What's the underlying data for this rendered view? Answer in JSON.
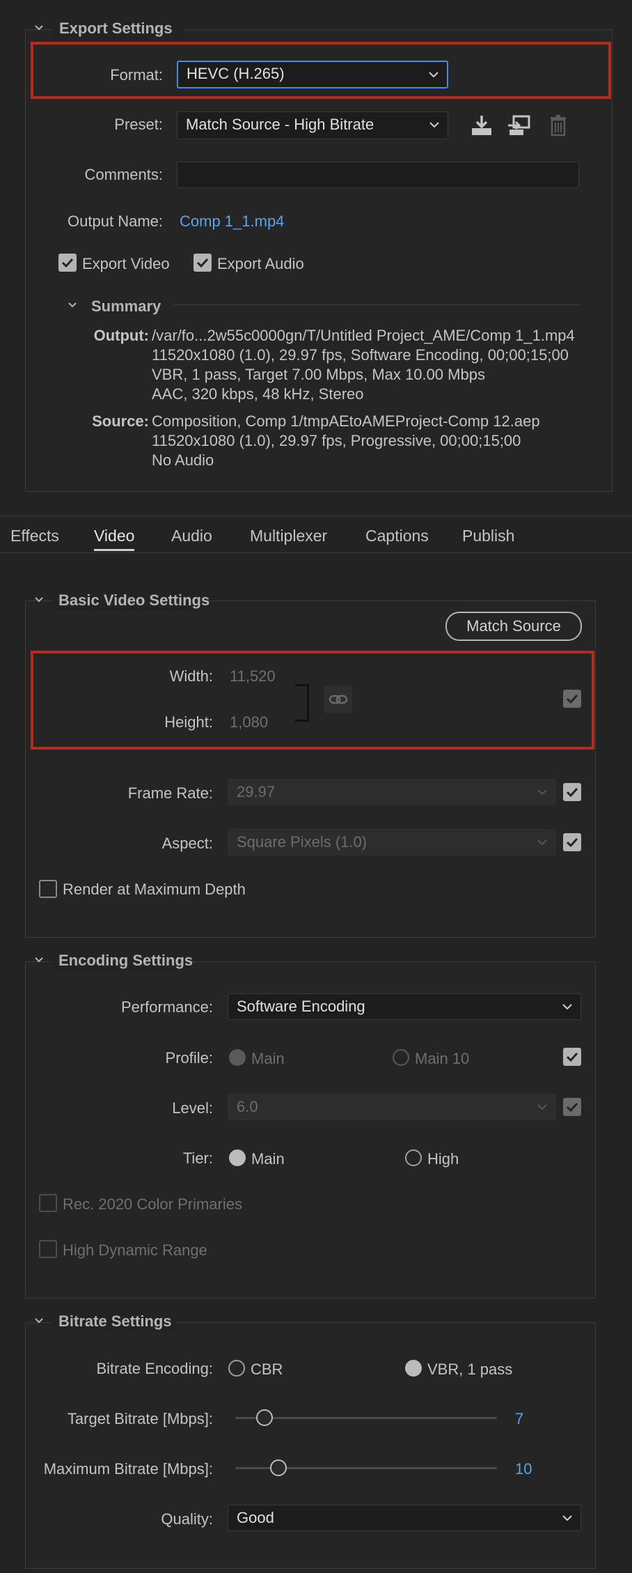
{
  "export_settings": {
    "title": "Export Settings",
    "format_label": "Format:",
    "format_value": "HEVC (H.265)",
    "preset_label": "Preset:",
    "preset_value": "Match Source - High Bitrate",
    "comments_label": "Comments:",
    "comments_value": "",
    "output_name_label": "Output Name:",
    "output_name_value": "Comp 1_1.mp4",
    "export_video_label": "Export Video",
    "export_video_checked": true,
    "export_audio_label": "Export Audio",
    "export_audio_checked": true,
    "summary": {
      "title": "Summary",
      "output_label": "Output:",
      "output_lines": [
        "/var/fo...2w55c0000gn/T/Untitled Project_AME/Comp 1_1.mp4",
        "11520x1080 (1.0), 29.97 fps, Software Encoding, 00;00;15;00",
        "VBR, 1 pass, Target 7.00 Mbps, Max 10.00 Mbps",
        "AAC, 320 kbps, 48 kHz, Stereo"
      ],
      "source_label": "Source:",
      "source_lines": [
        "Composition, Comp 1/tmpAEtoAMEProject-Comp 12.aep",
        "11520x1080 (1.0), 29.97 fps, Progressive, 00;00;15;00",
        "No Audio"
      ]
    }
  },
  "tabs": [
    {
      "label": "Effects",
      "active": false
    },
    {
      "label": "Video",
      "active": true
    },
    {
      "label": "Audio",
      "active": false
    },
    {
      "label": "Multiplexer",
      "active": false
    },
    {
      "label": "Captions",
      "active": false
    },
    {
      "label": "Publish",
      "active": false
    }
  ],
  "basic_video": {
    "title": "Basic Video Settings",
    "match_source_label": "Match Source",
    "width_label": "Width:",
    "width_value": "11,520",
    "height_label": "Height:",
    "height_value": "1,080",
    "frame_rate_label": "Frame Rate:",
    "frame_rate_value": "29.97",
    "aspect_label": "Aspect:",
    "aspect_value": "Square Pixels (1.0)",
    "render_max_depth_label": "Render at Maximum Depth"
  },
  "encoding": {
    "title": "Encoding Settings",
    "performance_label": "Performance:",
    "performance_value": "Software Encoding",
    "profile_label": "Profile:",
    "profile_opt1": "Main",
    "profile_opt2": "Main 10",
    "level_label": "Level:",
    "level_value": "6.0",
    "tier_label": "Tier:",
    "tier_opt1": "Main",
    "tier_opt2": "High",
    "rec2020_label": "Rec. 2020 Color Primaries",
    "hdr_label": "High Dynamic Range"
  },
  "bitrate": {
    "title": "Bitrate Settings",
    "encoding_label": "Bitrate Encoding:",
    "cbr_label": "CBR",
    "vbr_label": "VBR, 1 pass",
    "target_label": "Target Bitrate [Mbps]:",
    "target_value": "7",
    "max_label": "Maximum Bitrate [Mbps]:",
    "max_value": "10",
    "quality_label": "Quality:",
    "quality_value": "Good"
  },
  "colors": {
    "highlight_box": "#b72a1e",
    "link_blue": "#5aa3ee",
    "focus_blue": "#3f8ee5"
  }
}
